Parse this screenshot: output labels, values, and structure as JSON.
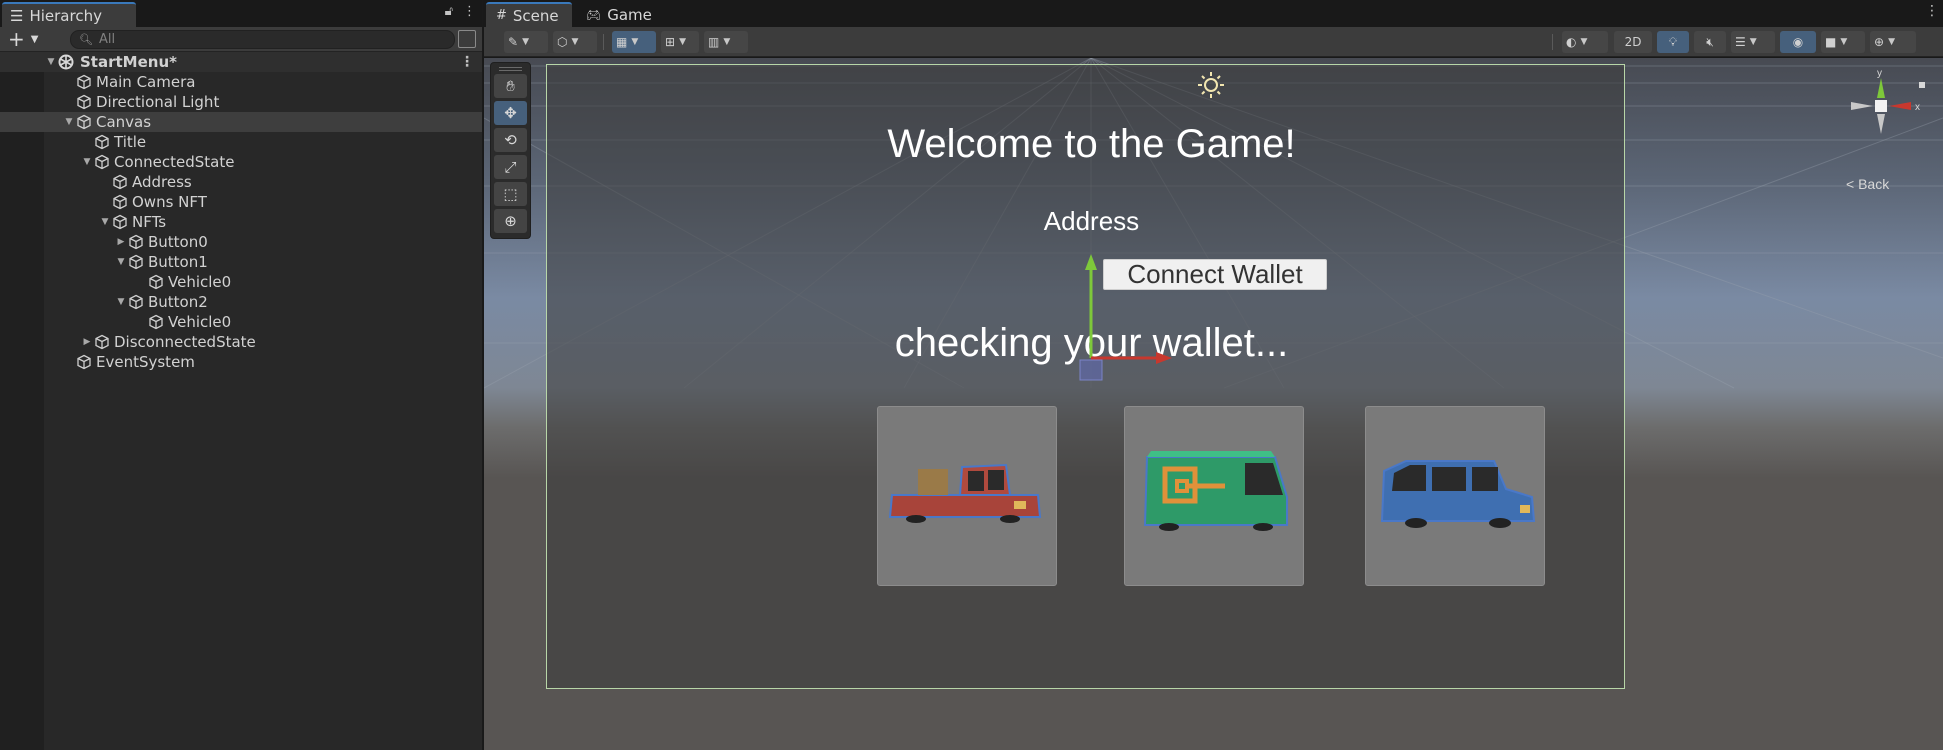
{
  "hierarchy": {
    "tab_label": "Hierarchy",
    "search_placeholder": "All",
    "items": [
      {
        "label": "StartMenu*"
      },
      {
        "label": "Main Camera"
      },
      {
        "label": "Directional Light"
      },
      {
        "label": "Canvas"
      },
      {
        "label": "Title"
      },
      {
        "label": "ConnectedState"
      },
      {
        "label": "Address"
      },
      {
        "label": "Owns NFT"
      },
      {
        "label": "NFTs"
      },
      {
        "label": "Button0"
      },
      {
        "label": "Button1"
      },
      {
        "label": "Vehicle0"
      },
      {
        "label": "Button2"
      },
      {
        "label": "Vehicle0"
      },
      {
        "label": "DisconnectedState"
      },
      {
        "label": "EventSystem"
      }
    ]
  },
  "scene": {
    "tabs": [
      {
        "label": "Scene"
      },
      {
        "label": "Game"
      }
    ],
    "toolbar": {
      "mode_2d_label": "2D"
    },
    "game_view": {
      "title": "Welcome to the Game!",
      "address_label": "Address",
      "connect_button": "Connect Wallet",
      "status_text": "checking your wallet...",
      "nft_cards": [
        {
          "vehicle": "red-pickup-truck",
          "color": "#a8443a"
        },
        {
          "vehicle": "green-delivery-van",
          "color": "#2e9a68"
        },
        {
          "vehicle": "blue-suv",
          "color": "#3f6fb1"
        }
      ]
    },
    "gizmo": {
      "y_label": "y",
      "x_label": "x",
      "back_label": "Back"
    }
  },
  "colors": {
    "accent": "#3a79bb",
    "panel_bg": "#282828",
    "toolbar_bg": "#3c3c3c",
    "selected_tool": "#46607c"
  }
}
